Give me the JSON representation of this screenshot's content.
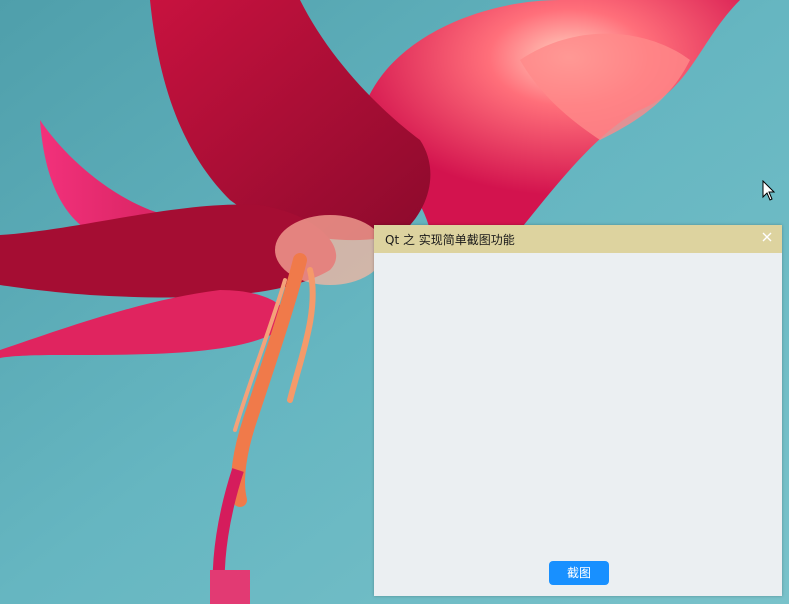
{
  "window": {
    "title": "Qt 之 实现简单截图功能",
    "close_icon": "close-icon",
    "titlebar_color": "#ddd39f",
    "background_color": "#ebeff2"
  },
  "main": {
    "capture_button_label": "截图",
    "capture_button_color": "#1890ff"
  },
  "desktop": {
    "wallpaper": "pink-flower-photo",
    "cursor_icon": "mouse-pointer-icon"
  }
}
